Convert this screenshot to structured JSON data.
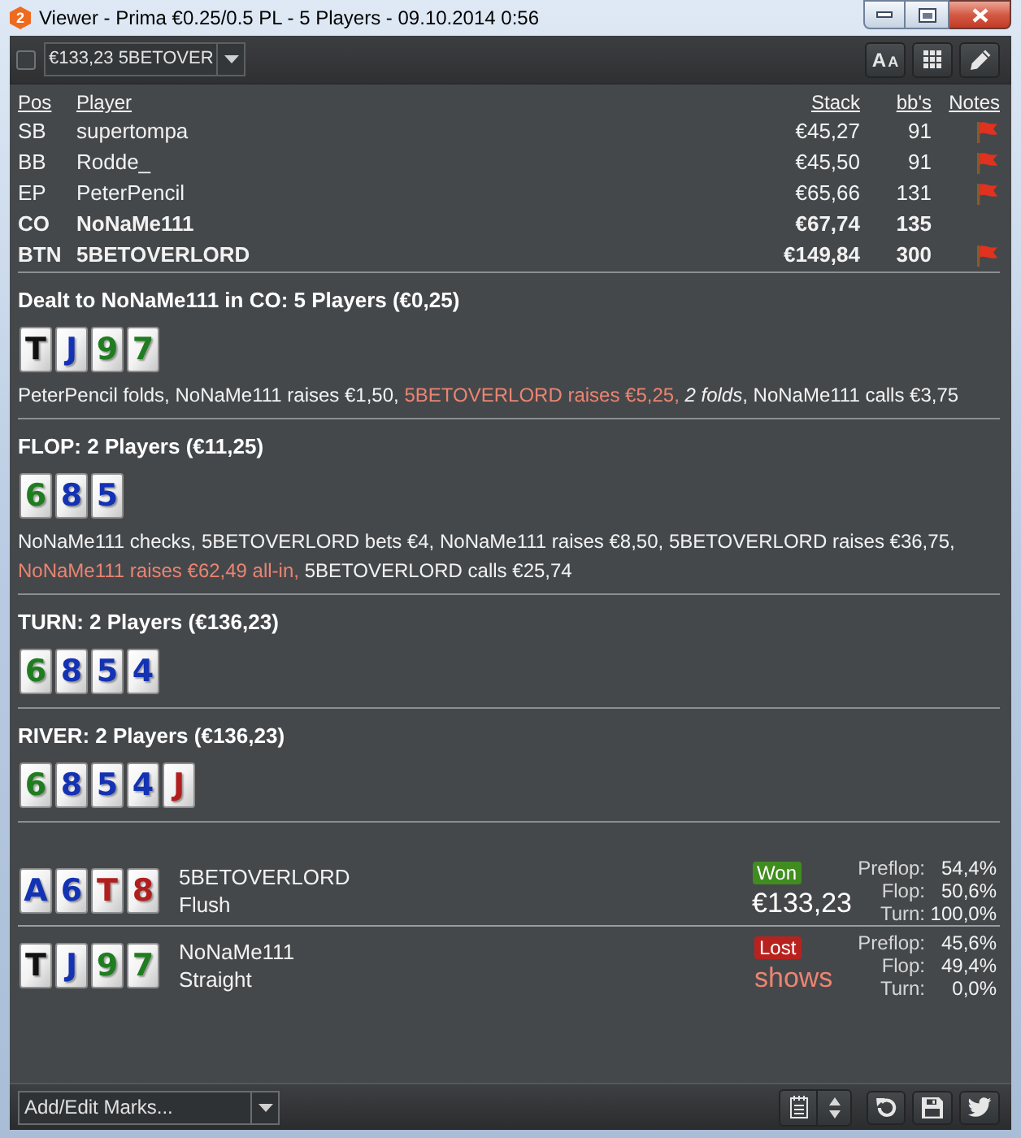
{
  "window": {
    "logo_text": "2",
    "title": "Viewer - Prima €0.25/0.5 PL - 5 Players - 09.10.2014 0:56"
  },
  "toolbar": {
    "checkbox": {
      "checked": false
    },
    "hand_selector": {
      "value": "€133,23 5BETOVER"
    },
    "text_size_button": {
      "large_letter": "A",
      "small_letter": "A"
    }
  },
  "players_table": {
    "columns": [
      "Pos",
      "Player",
      "Stack",
      "bb's",
      "Notes"
    ],
    "rows": [
      {
        "pos": "SB",
        "player": "supertompa",
        "stack": "€45,27",
        "bbs": "91",
        "has_note": true,
        "highlighted": false
      },
      {
        "pos": "BB",
        "player": "Rodde_",
        "stack": "€45,50",
        "bbs": "91",
        "has_note": true,
        "highlighted": false
      },
      {
        "pos": "EP",
        "player": "PeterPencil",
        "stack": "€65,66",
        "bbs": "131",
        "has_note": true,
        "highlighted": false
      },
      {
        "pos": "CO",
        "player": "NoNaMe111",
        "stack": "€67,74",
        "bbs": "135",
        "has_note": false,
        "highlighted": true
      },
      {
        "pos": "BTN",
        "player": "5BETOVERLORD",
        "stack": "€149,84",
        "bbs": "300",
        "has_note": true,
        "highlighted": true
      }
    ]
  },
  "streets": [
    {
      "heading": "Dealt to NoNaMe111 in CO: 5 Players (€0,25)",
      "cards": [
        {
          "rank": "T",
          "color": "#111111"
        },
        {
          "rank": "J",
          "color": "#1432b4"
        },
        {
          "rank": "9",
          "color": "#1f7d1f"
        },
        {
          "rank": "7",
          "color": "#1f7d1f"
        }
      ],
      "actions": [
        {
          "text": "PeterPencil folds,",
          "highlight": false
        },
        {
          "text": "NoNaMe111 raises €1,50,",
          "highlight": false
        },
        {
          "text": "5BETOVERLORD raises €5,25,",
          "highlight": true
        },
        {
          "text": "*2 folds*,",
          "highlight": false
        },
        {
          "text": "NoNaMe111 calls €3,75",
          "highlight": false
        }
      ]
    },
    {
      "heading": "FLOP: 2 Players (€11,25)",
      "cards": [
        {
          "rank": "6",
          "color": "#1f7d1f"
        },
        {
          "rank": "8",
          "color": "#1432b4"
        },
        {
          "rank": "5",
          "color": "#1432b4"
        }
      ],
      "actions": [
        {
          "text": "NoNaMe111 checks,",
          "highlight": false
        },
        {
          "text": "5BETOVERLORD bets €4,",
          "highlight": false
        },
        {
          "text": "NoNaMe111 raises €8,50,",
          "highlight": false
        },
        {
          "text": "5BETOVERLORD raises €36,75,",
          "highlight": false
        },
        {
          "text": "NoNaMe111 raises €62,49 all-in,",
          "highlight": true
        },
        {
          "text": "5BETOVERLORD calls €25,74",
          "highlight": false
        }
      ]
    },
    {
      "heading": "TURN: 2 Players (€136,23)",
      "cards": [
        {
          "rank": "6",
          "color": "#1f7d1f"
        },
        {
          "rank": "8",
          "color": "#1432b4"
        },
        {
          "rank": "5",
          "color": "#1432b4"
        },
        {
          "rank": "4",
          "color": "#1432b4"
        }
      ]
    },
    {
      "heading": "RIVER: 2 Players (€136,23)",
      "cards": [
        {
          "rank": "6",
          "color": "#1f7d1f"
        },
        {
          "rank": "8",
          "color": "#1432b4"
        },
        {
          "rank": "5",
          "color": "#1432b4"
        },
        {
          "rank": "4",
          "color": "#1432b4"
        },
        {
          "rank": "J",
          "color": "#b01e1e"
        }
      ]
    }
  ],
  "results": [
    {
      "kind": "won",
      "cards": [
        {
          "rank": "A",
          "color": "#1432b4"
        },
        {
          "rank": "6",
          "color": "#1432b4"
        },
        {
          "rank": "T",
          "color": "#b01e1e"
        },
        {
          "rank": "8",
          "color": "#b01e1e"
        }
      ],
      "player": "5BETOVERLORD",
      "hand": "Flush",
      "badge": "Won",
      "amount": "€133,23",
      "equity": [
        {
          "label": "Preflop:",
          "value": "54,4%"
        },
        {
          "label": "Flop:",
          "value": "50,6%"
        },
        {
          "label": "Turn:",
          "value": "100,0%"
        }
      ]
    },
    {
      "kind": "lost",
      "cards": [
        {
          "rank": "T",
          "color": "#111111"
        },
        {
          "rank": "J",
          "color": "#1432b4"
        },
        {
          "rank": "9",
          "color": "#1f7d1f"
        },
        {
          "rank": "7",
          "color": "#1f7d1f"
        }
      ],
      "player": "NoNaMe111",
      "hand": "Straight",
      "badge": "Lost",
      "amount": "shows",
      "equity": [
        {
          "label": "Preflop:",
          "value": "45,6%"
        },
        {
          "label": "Flop:",
          "value": "49,4%"
        },
        {
          "label": "Turn:",
          "value": "0,0%"
        }
      ]
    }
  ],
  "bottom_bar": {
    "marks_selector": {
      "value": "Add/Edit Marks..."
    }
  }
}
